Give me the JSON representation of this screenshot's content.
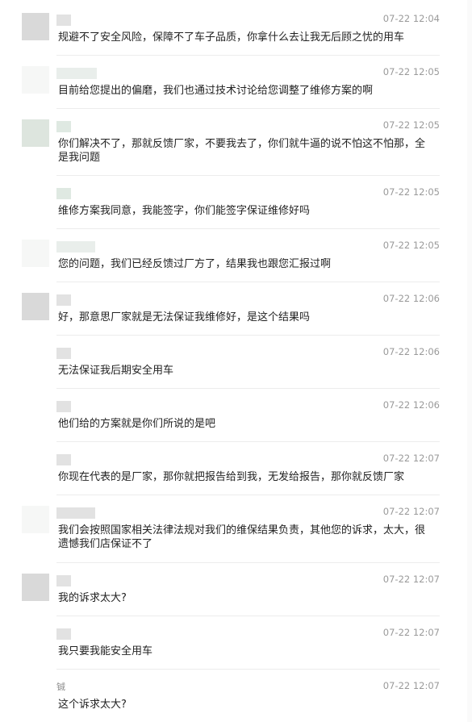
{
  "messages": [
    {
      "name": "",
      "time": "07-22 12:04",
      "text": "规避不了安全风险，保障不了车子品质，你拿什么去让我无后顾之忧的用车"
    },
    {
      "name": "",
      "time": "07-22 12:05",
      "text": "目前给您提出的偏磨，我们也通过技术讨论给您调整了维修方案的啊"
    },
    {
      "name": "",
      "time": "07-22 12:05",
      "text": "你们解决不了，那就反馈厂家，不要我去了，你们就牛逼的说不怕这不怕那，全是我问题"
    },
    {
      "name": "",
      "time": "07-22 12:05",
      "text": "维修方案我同意，我能签字，你们能签字保证维修好吗"
    },
    {
      "name": "",
      "time": "07-22 12:05",
      "text": "您的问题，我们已经反馈过厂方了，结果我也跟您汇报过啊"
    },
    {
      "name": "",
      "time": "07-22 12:06",
      "text": "好，那意思厂家就是无法保证我维修好，是这个结果吗"
    },
    {
      "name": "",
      "time": "07-22 12:06",
      "text": "无法保证我后期安全用车"
    },
    {
      "name": "",
      "time": "07-22 12:06",
      "text": "他们给的方案就是你们所说的是吧"
    },
    {
      "name": "",
      "time": "07-22 12:07",
      "text": "你现在代表的是厂家，那你就把报告给到我，无发给报告，那你就反馈厂家"
    },
    {
      "name": "",
      "time": "07-22 12:07",
      "text": "我们会按照国家相关法律法规对我们的维保结果负责，其他您的诉求，太大，很遗憾我们店保证不了"
    },
    {
      "name": "",
      "time": "07-22 12:07",
      "text": "我的诉求太大?"
    },
    {
      "name": "",
      "time": "07-22 12:07",
      "text": "我只要我能安全用车"
    },
    {
      "name": "铖",
      "time": "07-22 12:07",
      "text": "这个诉求太大?"
    }
  ]
}
